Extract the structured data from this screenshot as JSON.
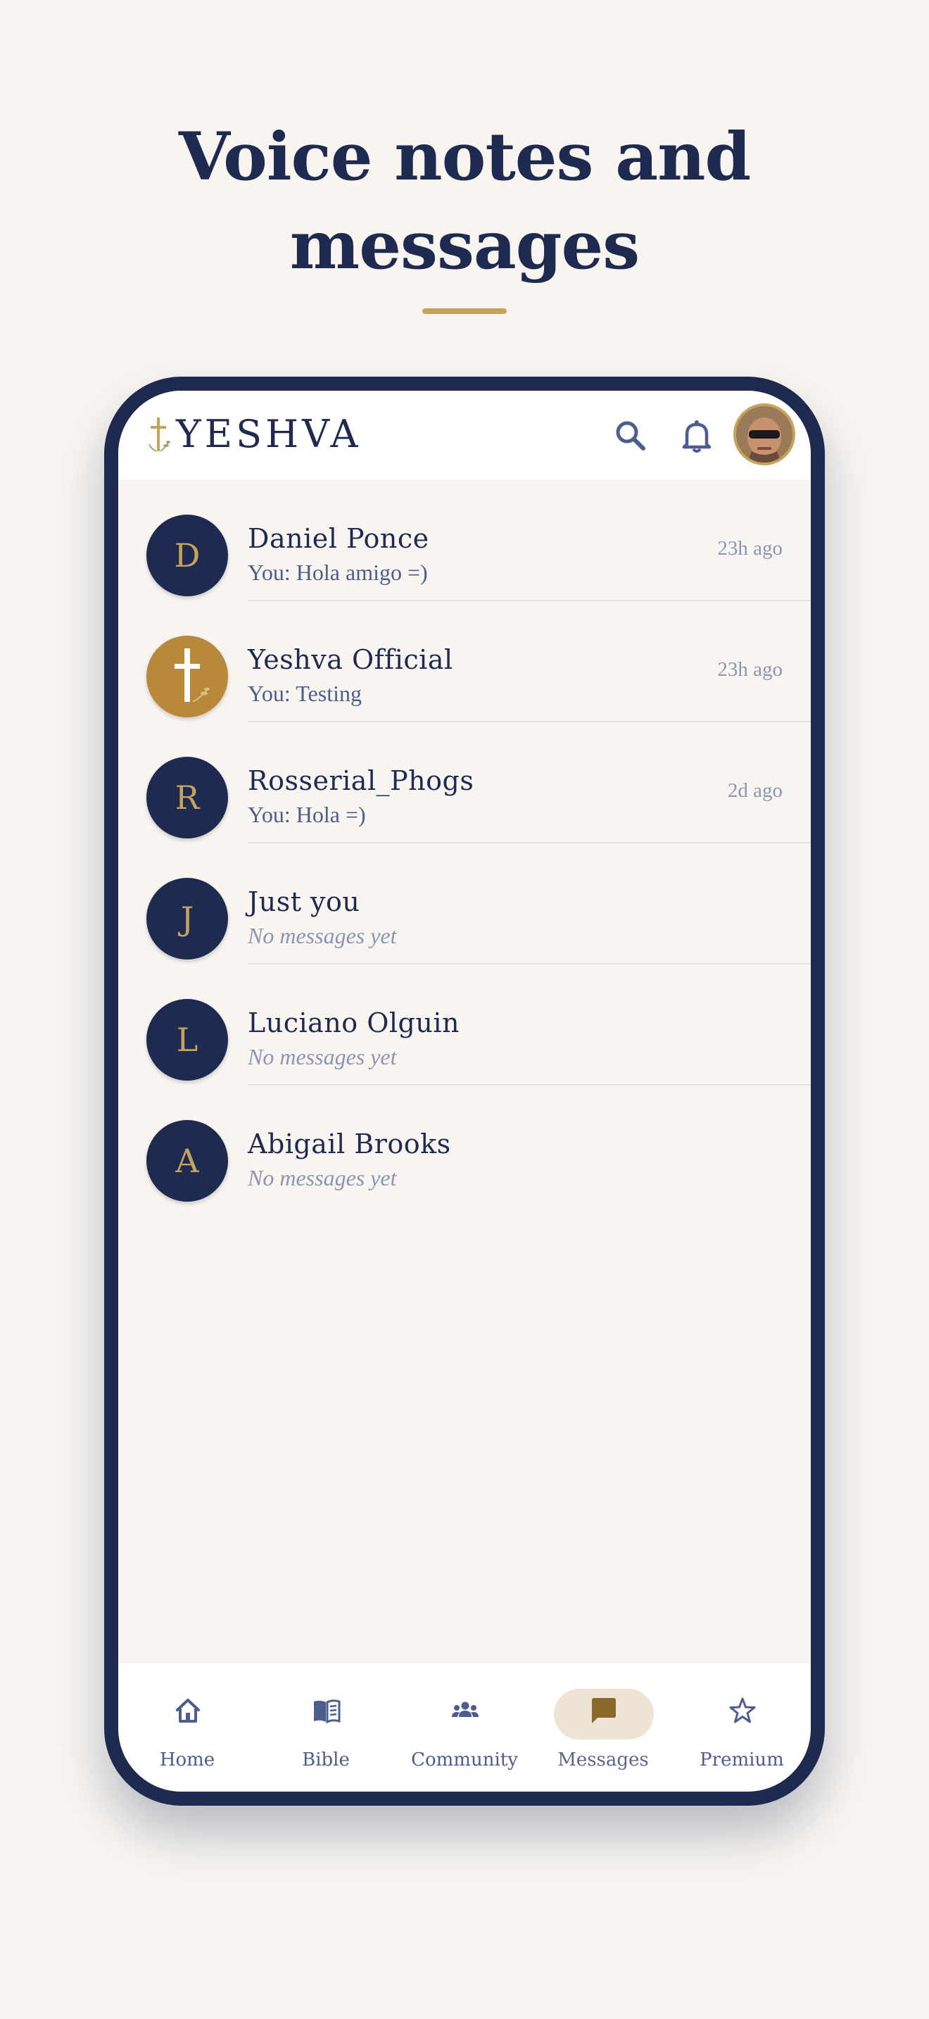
{
  "headline": {
    "line1": "Voice notes and",
    "line2": "messages"
  },
  "app": {
    "logo_text": "YESHVA",
    "logo_icon": "cross-sprig-icon",
    "search_icon": "search-icon",
    "notifications_icon": "bell-icon",
    "profile_avatar": "user-photo-avatar"
  },
  "conversations": [
    {
      "initial": "D",
      "name": "Daniel Ponce",
      "preview": "You: Hola amigo =)",
      "time": "23h ago"
    },
    {
      "initial": "",
      "name": "Yeshva Official",
      "preview": "You: Testing",
      "time": "23h ago",
      "icon": "cross-icon"
    },
    {
      "initial": "R",
      "name": "Rosserial_Phogs",
      "preview": "You: Hola =)",
      "time": "2d ago"
    },
    {
      "initial": "J",
      "name": "Just you",
      "preview": "No messages yet",
      "time": ""
    },
    {
      "initial": "L",
      "name": "Luciano Olguin",
      "preview": "No messages yet",
      "time": ""
    },
    {
      "initial": "A",
      "name": "Abigail Brooks",
      "preview": "No messages yet",
      "time": ""
    }
  ],
  "nav": [
    {
      "label": "Home",
      "icon": "home-icon"
    },
    {
      "label": "Bible",
      "icon": "book-icon"
    },
    {
      "label": "Community",
      "icon": "people-icon"
    },
    {
      "label": "Messages",
      "icon": "chat-bubble-icon",
      "active": true
    },
    {
      "label": "Premium",
      "icon": "star-icon"
    }
  ],
  "colors": {
    "navy": "#1e2a50",
    "gold": "#c4a35a",
    "background": "#f8f5f1",
    "active_pill": "#ede4d3"
  }
}
